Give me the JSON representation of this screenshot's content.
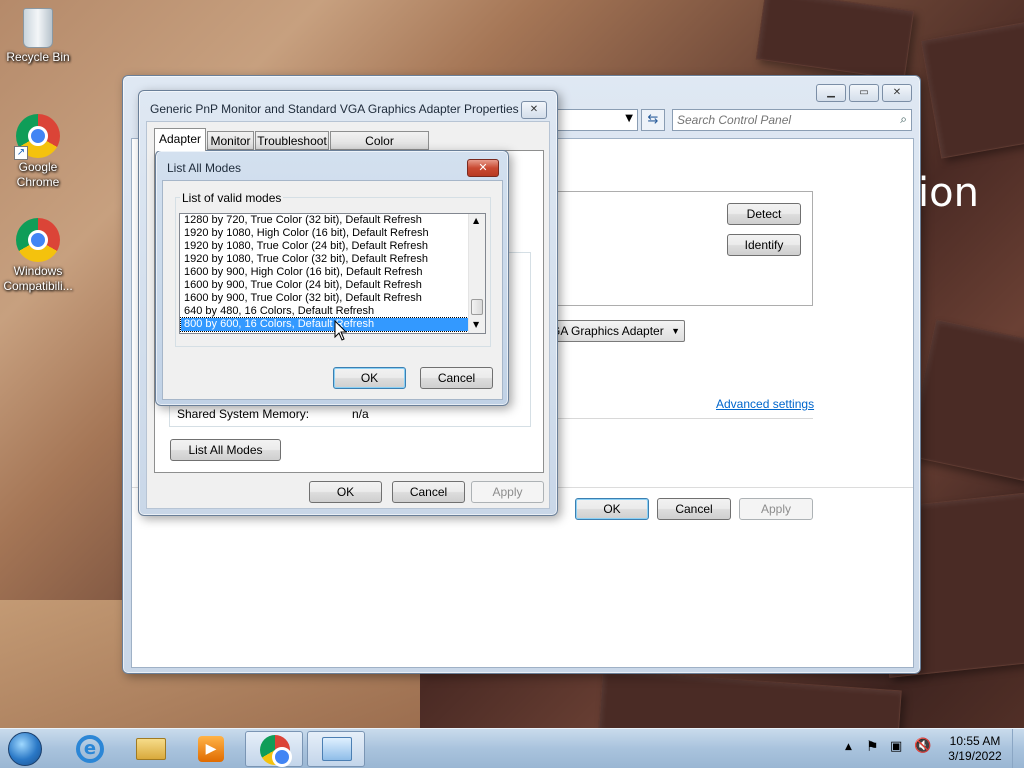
{
  "desktop": {
    "icons": [
      {
        "label": "Recycle Bin"
      },
      {
        "label": "Google Chrome"
      },
      {
        "label": "Windows Compatibili..."
      }
    ],
    "wallpaper_text": "ion"
  },
  "control_panel": {
    "search_placeholder": "Search Control Panel",
    "detect": "Detect",
    "identify": "Identify",
    "display_select": "GA Graphics Adapter",
    "advanced_link": "Advanced settings",
    "ok": "OK",
    "cancel": "Cancel",
    "apply": "Apply"
  },
  "properties": {
    "title": "Generic PnP Monitor and Standard VGA Graphics Adapter Properties",
    "tabs": [
      "Adapter",
      "Monitor",
      "Troubleshoot",
      "Color Management"
    ],
    "active_tab": "Adapter",
    "shared_memory_label": "Shared System Memory:",
    "shared_memory_value": "n/a",
    "list_all_modes_button": "List All Modes",
    "ok": "OK",
    "cancel": "Cancel",
    "apply": "Apply"
  },
  "modes_dialog": {
    "title": "List All Modes",
    "group_label": "List of valid modes",
    "modes": [
      "1280 by 720, True Color (32 bit), Default Refresh",
      "1920 by 1080, High Color (16 bit), Default Refresh",
      "1920 by 1080, True Color (24 bit), Default Refresh",
      "1920 by 1080, True Color (32 bit), Default Refresh",
      "1600 by 900, High Color (16 bit), Default Refresh",
      "1600 by 900, True Color (24 bit), Default Refresh",
      "1600 by 900, True Color (32 bit), Default Refresh",
      "640 by 480, 16 Colors, Default Refresh",
      "800 by 600, 16 Colors, Default Refresh"
    ],
    "selected_index": 8,
    "ok": "OK",
    "cancel": "Cancel"
  },
  "taskbar": {
    "time": "10:55 AM",
    "date": "3/19/2022",
    "apps": [
      "start-orb",
      "internet-explorer-icon",
      "file-explorer-icon",
      "media-player-icon",
      "chrome-icon",
      "control-panel-icon"
    ]
  },
  "colors": {
    "selection": "#3399ff",
    "link": "#0066cc",
    "titlebar": "#c9d7e8"
  }
}
